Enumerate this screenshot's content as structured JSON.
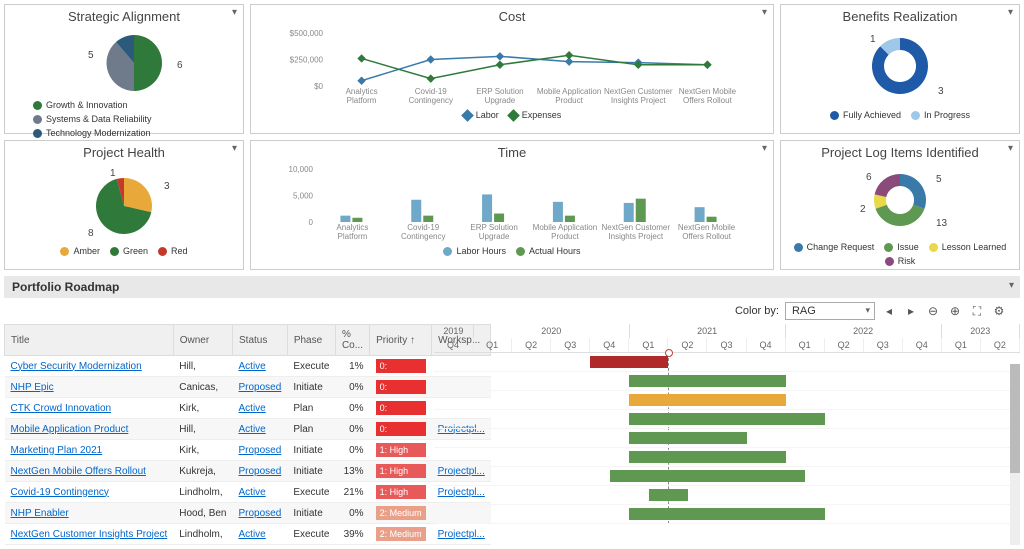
{
  "cards": {
    "strategic": {
      "title": "Strategic Alignment",
      "legend": [
        "Growth & Innovation",
        "Systems & Data Reliability",
        "Technology Modernization"
      ]
    },
    "cost": {
      "title": "Cost",
      "legend": [
        "Labor",
        "Expenses"
      ]
    },
    "benefits": {
      "title": "Benefits Realization",
      "legend": [
        "Fully Achieved",
        "In Progress"
      ]
    },
    "health": {
      "title": "Project Health",
      "legend": [
        "Amber",
        "Green",
        "Red"
      ]
    },
    "time": {
      "title": "Time",
      "legend": [
        "Labor Hours",
        "Actual Hours"
      ]
    },
    "log": {
      "title": "Project Log Items Identified",
      "legend": [
        "Change Request",
        "Issue",
        "Lesson Learned",
        "Risk"
      ]
    }
  },
  "chart_data": [
    {
      "id": "strategic",
      "type": "pie",
      "title": "Strategic Alignment",
      "series": [
        {
          "name": "Growth & Innovation",
          "value": 6,
          "color": "#2f7a3a"
        },
        {
          "name": "Systems & Data Reliability",
          "value": 5,
          "color": "#6f7a8a"
        },
        {
          "name": "Technology Modernization",
          "value": 1,
          "color": "#2b5a7a"
        }
      ]
    },
    {
      "id": "cost",
      "type": "line",
      "title": "Cost",
      "ylabel": "",
      "ylim": [
        0,
        500000
      ],
      "yticks": [
        0,
        250000,
        500000
      ],
      "ytick_labels": [
        "$0",
        "$250,000",
        "$500,000"
      ],
      "categories": [
        "Analytics Platform",
        "Covid-19 Contingency",
        "ERP Solution Upgrade",
        "Mobile Application Product",
        "NextGen Customer Insights Project",
        "NextGen Mobile Offers Rollout"
      ],
      "series": [
        {
          "name": "Labor",
          "color": "#3a7aa8",
          "values": [
            50000,
            250000,
            280000,
            230000,
            220000,
            200000
          ]
        },
        {
          "name": "Expenses",
          "color": "#2f7a3a",
          "values": [
            260000,
            70000,
            200000,
            290000,
            200000,
            200000
          ]
        }
      ]
    },
    {
      "id": "benefits",
      "type": "pie",
      "title": "Benefits Realization",
      "series": [
        {
          "name": "Fully Achieved",
          "value": 3,
          "color": "#1f5aa8"
        },
        {
          "name": "In Progress",
          "value": 1,
          "color": "#9fc8e8"
        }
      ]
    },
    {
      "id": "health",
      "type": "pie",
      "title": "Project Health",
      "series": [
        {
          "name": "Amber",
          "value": 3,
          "color": "#e8a93a"
        },
        {
          "name": "Green",
          "value": 8,
          "color": "#2f7a3a"
        },
        {
          "name": "Red",
          "value": 1,
          "color": "#c43a2a"
        }
      ]
    },
    {
      "id": "time",
      "type": "bar",
      "title": "Time",
      "ylim": [
        0,
        10000
      ],
      "yticks": [
        0,
        5000,
        10000
      ],
      "ytick_labels": [
        "0",
        "5,000",
        "10,000"
      ],
      "categories": [
        "Analytics Platform",
        "Covid-19 Contingency",
        "ERP Solution Upgrade",
        "Mobile Application Product",
        "NextGen Customer Insights Project",
        "NextGen Mobile Offers Rollout"
      ],
      "series": [
        {
          "name": "Labor Hours",
          "color": "#6fa8c8",
          "values": [
            1200,
            4200,
            5200,
            3800,
            3600,
            2800
          ]
        },
        {
          "name": "Actual Hours",
          "color": "#5f9850",
          "values": [
            800,
            1200,
            1600,
            1200,
            4400,
            1000
          ]
        }
      ]
    },
    {
      "id": "log",
      "type": "pie",
      "title": "Project Log Items Identified",
      "series": [
        {
          "name": "Change Request",
          "value": 5,
          "color": "#3a7aa8"
        },
        {
          "name": "Issue",
          "value": 13,
          "color": "#5f9850"
        },
        {
          "name": "Lesson Learned",
          "value": 2,
          "color": "#e8d84a"
        },
        {
          "name": "Risk",
          "value": 6,
          "color": "#8a4a7a"
        }
      ]
    }
  ],
  "roadmap": {
    "title": "Portfolio Roadmap",
    "color_by_label": "Color by:",
    "color_by_value": "RAG",
    "columns": [
      "Title",
      "Owner",
      "Status",
      "Phase",
      "% Co...",
      "Priority",
      "Worksp..."
    ],
    "years": [
      "2019",
      "2020",
      "2021",
      "2022",
      "2023"
    ],
    "quarters": [
      "Q4",
      "Q1",
      "Q2",
      "Q3",
      "Q4",
      "Q1",
      "Q2",
      "Q3",
      "Q4",
      "Q1",
      "Q2",
      "Q3",
      "Q4",
      "Q1",
      "Q2"
    ],
    "rows": [
      {
        "title": "Cyber Security Modernization",
        "owner": "Hill,",
        "status": "Active",
        "phase": "Execute",
        "pct": "1%",
        "priority": "0:",
        "pclass": "pr-red",
        "workspace": "",
        "bar": {
          "start": 4,
          "span": 2,
          "cls": "bar-red"
        }
      },
      {
        "title": "NHP Epic",
        "owner": "Canicas,",
        "status": "Proposed",
        "phase": "Initiate",
        "pct": "0%",
        "priority": "0:",
        "pclass": "pr-red",
        "workspace": "",
        "bar": {
          "start": 5,
          "span": 4,
          "cls": "bar-green"
        }
      },
      {
        "title": "CTK Crowd Innovation",
        "owner": "Kirk,",
        "status": "Active",
        "phase": "Plan",
        "pct": "0%",
        "priority": "0:",
        "pclass": "pr-red",
        "workspace": "",
        "bar": {
          "start": 5,
          "span": 4,
          "cls": "bar-amber"
        }
      },
      {
        "title": "Mobile Application Product",
        "owner": "Hill,",
        "status": "Active",
        "phase": "Plan",
        "pct": "0%",
        "priority": "0:",
        "pclass": "pr-red",
        "workspace": "Projectpl...",
        "bar": {
          "start": 5,
          "span": 5,
          "cls": "bar-green"
        }
      },
      {
        "title": "Marketing Plan 2021",
        "owner": "Kirk,",
        "status": "Proposed",
        "phase": "Initiate",
        "pct": "0%",
        "priority": "1: High",
        "pclass": "pr-high",
        "workspace": "",
        "bar": {
          "start": 5,
          "span": 3,
          "cls": "bar-green"
        }
      },
      {
        "title": "NextGen Mobile Offers Rollout",
        "owner": "Kukreja,",
        "status": "Proposed",
        "phase": "Initiate",
        "pct": "13%",
        "priority": "1: High",
        "pclass": "pr-high",
        "workspace": "Projectpl...",
        "bar": {
          "start": 5,
          "span": 4,
          "cls": "bar-green"
        }
      },
      {
        "title": "Covid-19 Contingency",
        "owner": "Lindholm,",
        "status": "Active",
        "phase": "Execute",
        "pct": "21%",
        "priority": "1: High",
        "pclass": "pr-high",
        "workspace": "Projectpl...",
        "bar": {
          "start": 4.5,
          "span": 5,
          "cls": "bar-green"
        }
      },
      {
        "title": "NHP Enabler",
        "owner": "Hood, Ben",
        "status": "Proposed",
        "phase": "Initiate",
        "pct": "0%",
        "priority": "2: Medium",
        "pclass": "pr-med",
        "workspace": "",
        "bar": {
          "start": 5.5,
          "span": 1,
          "cls": "bar-green"
        }
      },
      {
        "title": "NextGen Customer Insights Project",
        "owner": "Lindholm,",
        "status": "Active",
        "phase": "Execute",
        "pct": "39%",
        "priority": "2: Medium",
        "pclass": "pr-med",
        "workspace": "Projectpl...",
        "bar": {
          "start": 5,
          "span": 5,
          "cls": "bar-green"
        }
      }
    ]
  }
}
